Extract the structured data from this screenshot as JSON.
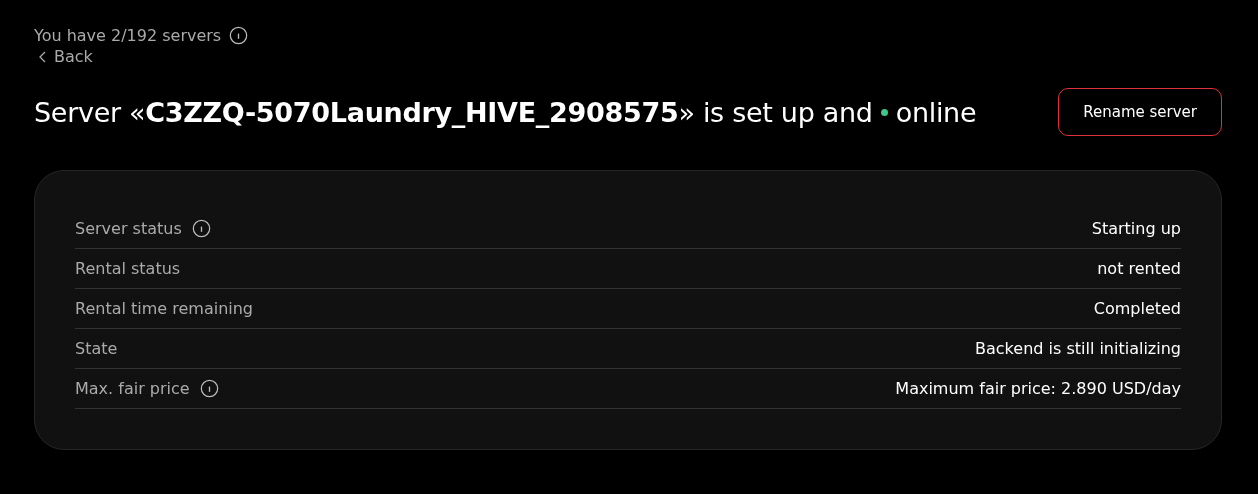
{
  "header": {
    "server_count": "You have 2/192 servers",
    "back": "Back"
  },
  "title": {
    "text": "Server «**C3ZZQ-5070Laundry_HIVE_2908575**» is set up and",
    "status": {
      "text": "online",
      "color": "#3fc68a"
    }
  },
  "rename_button": "Rename server",
  "details": [
    {
      "label": "Server status",
      "info": true,
      "value": "Starting up"
    },
    {
      "label": "Rental status",
      "info": false,
      "value": "not rented"
    },
    {
      "label": "Rental time remaining",
      "info": false,
      "value": "Completed"
    },
    {
      "label": "State",
      "info": false,
      "value": "Backend is still initializing"
    },
    {
      "label": "Max. fair price",
      "info": true,
      "value": "Maximum fair price: 2.890 USD/day"
    }
  ]
}
